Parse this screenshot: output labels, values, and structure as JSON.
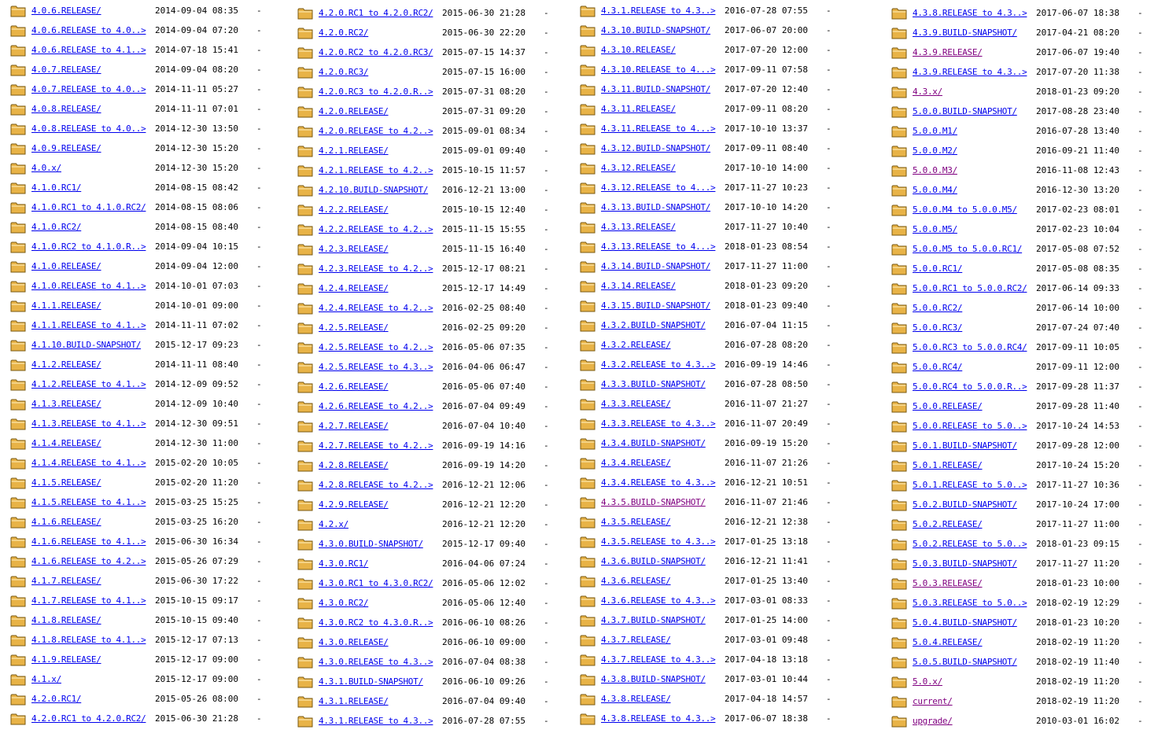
{
  "page": {
    "title": ""
  },
  "icons": {
    "entry_icon": "folder-icon",
    "folder_color": "#e8b347"
  },
  "colors": {
    "link": "#0000ee",
    "visited": "#800080"
  },
  "columns": [
    {
      "entries": [
        {
          "name": "4.0.6.RELEASE/",
          "date": "2014-09-04 08:35",
          "size": "-"
        },
        {
          "name": "4.0.6.RELEASE to 4.0..>",
          "date": "2014-09-04 07:20",
          "size": "-"
        },
        {
          "name": "4.0.6.RELEASE to 4.1..>",
          "date": "2014-07-18 15:41",
          "size": "-"
        },
        {
          "name": "4.0.7.RELEASE/",
          "date": "2014-09-04 08:20",
          "size": "-"
        },
        {
          "name": "4.0.7.RELEASE to 4.0..>",
          "date": "2014-11-11 05:27",
          "size": "-"
        },
        {
          "name": "4.0.8.RELEASE/",
          "date": "2014-11-11 07:01",
          "size": "-"
        },
        {
          "name": "4.0.8.RELEASE to 4.0..>",
          "date": "2014-12-30 13:50",
          "size": "-"
        },
        {
          "name": "4.0.9.RELEASE/",
          "date": "2014-12-30 15:20",
          "size": "-"
        },
        {
          "name": "4.0.x/",
          "date": "2014-12-30 15:20",
          "size": "-"
        },
        {
          "name": "4.1.0.RC1/",
          "date": "2014-08-15 08:42",
          "size": "-"
        },
        {
          "name": "4.1.0.RC1 to 4.1.0.RC2/",
          "date": "2014-08-15 08:06",
          "size": "-"
        },
        {
          "name": "4.1.0.RC2/",
          "date": "2014-08-15 08:40",
          "size": "-"
        },
        {
          "name": "4.1.0.RC2 to 4.1.0.R..>",
          "date": "2014-09-04 10:15",
          "size": "-"
        },
        {
          "name": "4.1.0.RELEASE/",
          "date": "2014-09-04 12:00",
          "size": "-"
        },
        {
          "name": "4.1.0.RELEASE to 4.1..>",
          "date": "2014-10-01 07:03",
          "size": "-"
        },
        {
          "name": "4.1.1.RELEASE/",
          "date": "2014-10-01 09:00",
          "size": "-"
        },
        {
          "name": "4.1.1.RELEASE to 4.1..>",
          "date": "2014-11-11 07:02",
          "size": "-"
        },
        {
          "name": "4.1.10.BUILD-SNAPSHOT/",
          "date": "2015-12-17 09:23",
          "size": "-"
        },
        {
          "name": "4.1.2.RELEASE/",
          "date": "2014-11-11 08:40",
          "size": "-"
        },
        {
          "name": "4.1.2.RELEASE to 4.1..>",
          "date": "2014-12-09 09:52",
          "size": "-"
        },
        {
          "name": "4.1.3.RELEASE/",
          "date": "2014-12-09 10:40",
          "size": "-"
        },
        {
          "name": "4.1.3.RELEASE to 4.1..>",
          "date": "2014-12-30 09:51",
          "size": "-"
        },
        {
          "name": "4.1.4.RELEASE/",
          "date": "2014-12-30 11:00",
          "size": "-"
        },
        {
          "name": "4.1.4.RELEASE to 4.1..>",
          "date": "2015-02-20 10:05",
          "size": "-"
        },
        {
          "name": "4.1.5.RELEASE/",
          "date": "2015-02-20 11:20",
          "size": "-"
        },
        {
          "name": "4.1.5.RELEASE to 4.1..>",
          "date": "2015-03-25 15:25",
          "size": "-"
        },
        {
          "name": "4.1.6.RELEASE/",
          "date": "2015-03-25 16:20",
          "size": "-"
        },
        {
          "name": "4.1.6.RELEASE to 4.1..>",
          "date": "2015-06-30 16:34",
          "size": "-"
        },
        {
          "name": "4.1.6.RELEASE to 4.2..>",
          "date": "2015-05-26 07:29",
          "size": "-"
        },
        {
          "name": "4.1.7.RELEASE/",
          "date": "2015-06-30 17:22",
          "size": "-"
        },
        {
          "name": "4.1.7.RELEASE to 4.1..>",
          "date": "2015-10-15 09:17",
          "size": "-"
        },
        {
          "name": "4.1.8.RELEASE/",
          "date": "2015-10-15 09:40",
          "size": "-"
        },
        {
          "name": "4.1.8.RELEASE to 4.1..>",
          "date": "2015-12-17 07:13",
          "size": "-"
        },
        {
          "name": "4.1.9.RELEASE/",
          "date": "2015-12-17 09:00",
          "size": "-"
        },
        {
          "name": "4.1.x/",
          "date": "2015-12-17 09:00",
          "size": "-"
        },
        {
          "name": "4.2.0.RC1/",
          "date": "2015-05-26 08:00",
          "size": "-"
        },
        {
          "name": "4.2.0.RC1 to 4.2.0.RC2/",
          "date": "2015-06-30 21:28",
          "size": "-"
        }
      ]
    },
    {
      "entries": [
        {
          "name": "4.2.0.RC1 to 4.2.0.RC2/",
          "date": "2015-06-30 21:28",
          "size": "-"
        },
        {
          "name": "4.2.0.RC2/",
          "date": "2015-06-30 22:20",
          "size": "-"
        },
        {
          "name": "4.2.0.RC2 to 4.2.0.RC3/",
          "date": "2015-07-15 14:37",
          "size": "-"
        },
        {
          "name": "4.2.0.RC3/",
          "date": "2015-07-15 16:00",
          "size": "-"
        },
        {
          "name": "4.2.0.RC3 to 4.2.0.R..>",
          "date": "2015-07-31 08:20",
          "size": "-"
        },
        {
          "name": "4.2.0.RELEASE/",
          "date": "2015-07-31 09:20",
          "size": "-"
        },
        {
          "name": "4.2.0.RELEASE to 4.2..>",
          "date": "2015-09-01 08:34",
          "size": "-"
        },
        {
          "name": "4.2.1.RELEASE/",
          "date": "2015-09-01 09:40",
          "size": "-"
        },
        {
          "name": "4.2.1.RELEASE to 4.2..>",
          "date": "2015-10-15 11:57",
          "size": "-"
        },
        {
          "name": "4.2.10.BUILD-SNAPSHOT/",
          "date": "2016-12-21 13:00",
          "size": "-"
        },
        {
          "name": "4.2.2.RELEASE/",
          "date": "2015-10-15 12:40",
          "size": "-"
        },
        {
          "name": "4.2.2.RELEASE to 4.2..>",
          "date": "2015-11-15 15:55",
          "size": "-"
        },
        {
          "name": "4.2.3.RELEASE/",
          "date": "2015-11-15 16:40",
          "size": "-"
        },
        {
          "name": "4.2.3.RELEASE to 4.2..>",
          "date": "2015-12-17 08:21",
          "size": "-"
        },
        {
          "name": "4.2.4.RELEASE/",
          "date": "2015-12-17 14:49",
          "size": "-"
        },
        {
          "name": "4.2.4.RELEASE to 4.2..>",
          "date": "2016-02-25 08:40",
          "size": "-"
        },
        {
          "name": "4.2.5.RELEASE/",
          "date": "2016-02-25 09:20",
          "size": "-"
        },
        {
          "name": "4.2.5.RELEASE to 4.2..>",
          "date": "2016-05-06 07:35",
          "size": "-"
        },
        {
          "name": "4.2.5.RELEASE to 4.3..>",
          "date": "2016-04-06 06:47",
          "size": "-"
        },
        {
          "name": "4.2.6.RELEASE/",
          "date": "2016-05-06 07:40",
          "size": "-"
        },
        {
          "name": "4.2.6.RELEASE to 4.2..>",
          "date": "2016-07-04 09:49",
          "size": "-"
        },
        {
          "name": "4.2.7.RELEASE/",
          "date": "2016-07-04 10:40",
          "size": "-"
        },
        {
          "name": "4.2.7.RELEASE to 4.2..>",
          "date": "2016-09-19 14:16",
          "size": "-"
        },
        {
          "name": "4.2.8.RELEASE/",
          "date": "2016-09-19 14:20",
          "size": "-"
        },
        {
          "name": "4.2.8.RELEASE to 4.2..>",
          "date": "2016-12-21 12:06",
          "size": "-"
        },
        {
          "name": "4.2.9.RELEASE/",
          "date": "2016-12-21 12:20",
          "size": "-"
        },
        {
          "name": "4.2.x/",
          "date": "2016-12-21 12:20",
          "size": "-"
        },
        {
          "name": "4.3.0.BUILD-SNAPSHOT/",
          "date": "2015-12-17 09:40",
          "size": "-"
        },
        {
          "name": "4.3.0.RC1/",
          "date": "2016-04-06 07:24",
          "size": "-"
        },
        {
          "name": "4.3.0.RC1 to 4.3.0.RC2/",
          "date": "2016-05-06 12:02",
          "size": "-"
        },
        {
          "name": "4.3.0.RC2/",
          "date": "2016-05-06 12:40",
          "size": "-"
        },
        {
          "name": "4.3.0.RC2 to 4.3.0.R..>",
          "date": "2016-06-10 08:26",
          "size": "-"
        },
        {
          "name": "4.3.0.RELEASE/",
          "date": "2016-06-10 09:00",
          "size": "-"
        },
        {
          "name": "4.3.0.RELEASE to 4.3..>",
          "date": "2016-07-04 08:38",
          "size": "-"
        },
        {
          "name": "4.3.1.BUILD-SNAPSHOT/",
          "date": "2016-06-10 09:26",
          "size": "-"
        },
        {
          "name": "4.3.1.RELEASE/",
          "date": "2016-07-04 09:40",
          "size": "-"
        },
        {
          "name": "4.3.1.RELEASE to 4.3..>",
          "date": "2016-07-28 07:55",
          "size": "-"
        }
      ]
    },
    {
      "entries": [
        {
          "name": "4.3.1.RELEASE to 4.3..>",
          "date": "2016-07-28 07:55",
          "size": "-"
        },
        {
          "name": "4.3.10.BUILD-SNAPSHOT/",
          "date": "2017-06-07 20:00",
          "size": "-"
        },
        {
          "name": "4.3.10.RELEASE/",
          "date": "2017-07-20 12:00",
          "size": "-"
        },
        {
          "name": "4.3.10.RELEASE to 4...>",
          "date": "2017-09-11 07:58",
          "size": "-"
        },
        {
          "name": "4.3.11.BUILD-SNAPSHOT/",
          "date": "2017-07-20 12:40",
          "size": "-"
        },
        {
          "name": "4.3.11.RELEASE/",
          "date": "2017-09-11 08:20",
          "size": "-"
        },
        {
          "name": "4.3.11.RELEASE to 4...>",
          "date": "2017-10-10 13:37",
          "size": "-"
        },
        {
          "name": "4.3.12.BUILD-SNAPSHOT/",
          "date": "2017-09-11 08:40",
          "size": "-"
        },
        {
          "name": "4.3.12.RELEASE/",
          "date": "2017-10-10 14:00",
          "size": "-"
        },
        {
          "name": "4.3.12.RELEASE to 4...>",
          "date": "2017-11-27 10:23",
          "size": "-"
        },
        {
          "name": "4.3.13.BUILD-SNAPSHOT/",
          "date": "2017-10-10 14:20",
          "size": "-"
        },
        {
          "name": "4.3.13.RELEASE/",
          "date": "2017-11-27 10:40",
          "size": "-"
        },
        {
          "name": "4.3.13.RELEASE to 4...>",
          "date": "2018-01-23 08:54",
          "size": "-"
        },
        {
          "name": "4.3.14.BUILD-SNAPSHOT/",
          "date": "2017-11-27 11:00",
          "size": "-"
        },
        {
          "name": "4.3.14.RELEASE/",
          "date": "2018-01-23 09:20",
          "size": "-"
        },
        {
          "name": "4.3.15.BUILD-SNAPSHOT/",
          "date": "2018-01-23 09:40",
          "size": "-"
        },
        {
          "name": "4.3.2.BUILD-SNAPSHOT/",
          "date": "2016-07-04 11:15",
          "size": "-"
        },
        {
          "name": "4.3.2.RELEASE/",
          "date": "2016-07-28 08:20",
          "size": "-"
        },
        {
          "name": "4.3.2.RELEASE to 4.3..>",
          "date": "2016-09-19 14:46",
          "size": "-"
        },
        {
          "name": "4.3.3.BUILD-SNAPSHOT/",
          "date": "2016-07-28 08:50",
          "size": "-"
        },
        {
          "name": "4.3.3.RELEASE/",
          "date": "2016-11-07 21:27",
          "size": "-"
        },
        {
          "name": "4.3.3.RELEASE to 4.3..>",
          "date": "2016-11-07 20:49",
          "size": "-"
        },
        {
          "name": "4.3.4.BUILD-SNAPSHOT/",
          "date": "2016-09-19 15:20",
          "size": "-"
        },
        {
          "name": "4.3.4.RELEASE/",
          "date": "2016-11-07 21:26",
          "size": "-"
        },
        {
          "name": "4.3.4.RELEASE to 4.3..>",
          "date": "2016-12-21 10:51",
          "size": "-"
        },
        {
          "name": "4.3.5.BUILD-SNAPSHOT/",
          "date": "2016-11-07 21:46",
          "size": "-",
          "visited": true
        },
        {
          "name": "4.3.5.RELEASE/",
          "date": "2016-12-21 12:38",
          "size": "-"
        },
        {
          "name": "4.3.5.RELEASE to 4.3..>",
          "date": "2017-01-25 13:18",
          "size": "-"
        },
        {
          "name": "4.3.6.BUILD-SNAPSHOT/",
          "date": "2016-12-21 11:41",
          "size": "-"
        },
        {
          "name": "4.3.6.RELEASE/",
          "date": "2017-01-25 13:40",
          "size": "-"
        },
        {
          "name": "4.3.6.RELEASE to 4.3..>",
          "date": "2017-03-01 08:33",
          "size": "-"
        },
        {
          "name": "4.3.7.BUILD-SNAPSHOT/",
          "date": "2017-01-25 14:00",
          "size": "-"
        },
        {
          "name": "4.3.7.RELEASE/",
          "date": "2017-03-01 09:48",
          "size": "-"
        },
        {
          "name": "4.3.7.RELEASE to 4.3..>",
          "date": "2017-04-18 13:18",
          "size": "-"
        },
        {
          "name": "4.3.8.BUILD-SNAPSHOT/",
          "date": "2017-03-01 10:44",
          "size": "-"
        },
        {
          "name": "4.3.8.RELEASE/",
          "date": "2017-04-18 14:57",
          "size": "-"
        },
        {
          "name": "4.3.8.RELEASE to 4.3..>",
          "date": "2017-06-07 18:38",
          "size": "-"
        }
      ]
    },
    {
      "entries": [
        {
          "name": "4.3.8.RELEASE to 4.3..>",
          "date": "2017-06-07 18:38",
          "size": "-"
        },
        {
          "name": "4.3.9.BUILD-SNAPSHOT/",
          "date": "2017-04-21 08:20",
          "size": "-"
        },
        {
          "name": "4.3.9.RELEASE/",
          "date": "2017-06-07 19:40",
          "size": "-",
          "visited": true
        },
        {
          "name": "4.3.9.RELEASE to 4.3..>",
          "date": "2017-07-20 11:38",
          "size": "-"
        },
        {
          "name": "4.3.x/",
          "date": "2018-01-23 09:20",
          "size": "-",
          "visited": true
        },
        {
          "name": "5.0.0.BUILD-SNAPSHOT/",
          "date": "2017-08-28 23:40",
          "size": "-"
        },
        {
          "name": "5.0.0.M1/",
          "date": "2016-07-28 13:40",
          "size": "-"
        },
        {
          "name": "5.0.0.M2/",
          "date": "2016-09-21 11:40",
          "size": "-"
        },
        {
          "name": "5.0.0.M3/",
          "date": "2016-11-08 12:43",
          "size": "-",
          "visited": true
        },
        {
          "name": "5.0.0.M4/",
          "date": "2016-12-30 13:20",
          "size": "-"
        },
        {
          "name": "5.0.0.M4 to 5.0.0.M5/",
          "date": "2017-02-23 08:01",
          "size": "-"
        },
        {
          "name": "5.0.0.M5/",
          "date": "2017-02-23 10:04",
          "size": "-"
        },
        {
          "name": "5.0.0.M5 to 5.0.0.RC1/",
          "date": "2017-05-08 07:52",
          "size": "-"
        },
        {
          "name": "5.0.0.RC1/",
          "date": "2017-05-08 08:35",
          "size": "-"
        },
        {
          "name": "5.0.0.RC1 to 5.0.0.RC2/",
          "date": "2017-06-14 09:33",
          "size": "-"
        },
        {
          "name": "5.0.0.RC2/",
          "date": "2017-06-14 10:00",
          "size": "-"
        },
        {
          "name": "5.0.0.RC3/",
          "date": "2017-07-24 07:40",
          "size": "-"
        },
        {
          "name": "5.0.0.RC3 to 5.0.0.RC4/",
          "date": "2017-09-11 10:05",
          "size": "-"
        },
        {
          "name": "5.0.0.RC4/",
          "date": "2017-09-11 12:00",
          "size": "-"
        },
        {
          "name": "5.0.0.RC4 to 5.0.0.R..>",
          "date": "2017-09-28 11:37",
          "size": "-"
        },
        {
          "name": "5.0.0.RELEASE/",
          "date": "2017-09-28 11:40",
          "size": "-"
        },
        {
          "name": "5.0.0.RELEASE to 5.0..>",
          "date": "2017-10-24 14:53",
          "size": "-"
        },
        {
          "name": "5.0.1.BUILD-SNAPSHOT/",
          "date": "2017-09-28 12:00",
          "size": "-"
        },
        {
          "name": "5.0.1.RELEASE/",
          "date": "2017-10-24 15:20",
          "size": "-"
        },
        {
          "name": "5.0.1.RELEASE to 5.0..>",
          "date": "2017-11-27 10:36",
          "size": "-"
        },
        {
          "name": "5.0.2.BUILD-SNAPSHOT/",
          "date": "2017-10-24 17:00",
          "size": "-"
        },
        {
          "name": "5.0.2.RELEASE/",
          "date": "2017-11-27 11:00",
          "size": "-"
        },
        {
          "name": "5.0.2.RELEASE to 5.0..>",
          "date": "2018-01-23 09:15",
          "size": "-"
        },
        {
          "name": "5.0.3.BUILD-SNAPSHOT/",
          "date": "2017-11-27 11:20",
          "size": "-"
        },
        {
          "name": "5.0.3.RELEASE/",
          "date": "2018-01-23 10:00",
          "size": "-",
          "visited": true
        },
        {
          "name": "5.0.3.RELEASE to 5.0..>",
          "date": "2018-02-19 12:29",
          "size": "-"
        },
        {
          "name": "5.0.4.BUILD-SNAPSHOT/",
          "date": "2018-01-23 10:20",
          "size": "-"
        },
        {
          "name": "5.0.4.RELEASE/",
          "date": "2018-02-19 11:20",
          "size": "-"
        },
        {
          "name": "5.0.5.BUILD-SNAPSHOT/",
          "date": "2018-02-19 11:40",
          "size": "-"
        },
        {
          "name": "5.0.x/",
          "date": "2018-02-19 11:20",
          "size": "-",
          "visited": true
        },
        {
          "name": "current/",
          "date": "2018-02-19 11:20",
          "size": "-",
          "visited": true
        },
        {
          "name": "upgrade/",
          "date": "2010-03-01 16:02",
          "size": "-",
          "visited": true
        }
      ]
    }
  ]
}
